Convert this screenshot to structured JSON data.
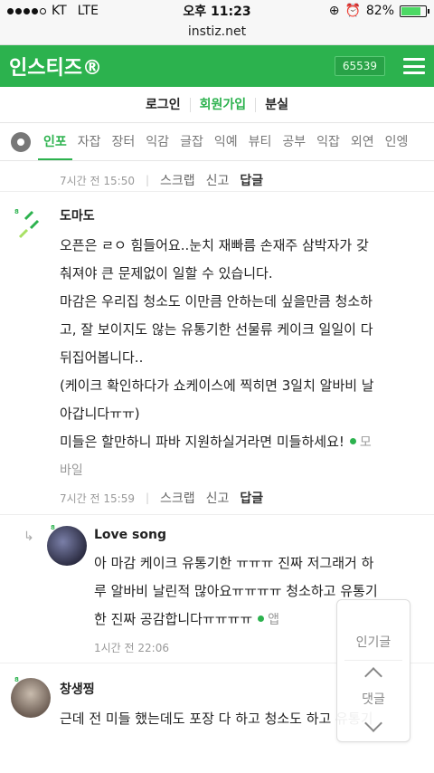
{
  "status": {
    "carrier": "KT",
    "network": "LTE",
    "time": "오후 11:23",
    "battery": "82%",
    "battery_level": 0.82
  },
  "url": "instiz.net",
  "brand": {
    "logo": "인스티즈®",
    "count": "65539"
  },
  "auth": {
    "login": "로그인",
    "signup": "회원가입",
    "lost": "분실"
  },
  "tabs": [
    "인포",
    "자잡",
    "장터",
    "익감",
    "글잡",
    "익예",
    "뷰티",
    "공부",
    "익잡",
    "외연",
    "인엥"
  ],
  "actions": {
    "scrap": "스크랩",
    "report": "신고",
    "reply": "답글"
  },
  "top_meta": {
    "time": "7시간 전 15:50"
  },
  "comments": [
    {
      "name": "도마도",
      "lines": [
        "오픈은 ㄹㅇ 힘들어요..눈치 재빠름 손재주 삼박자가 갖",
        "춰져야 큰 문제없이 일할 수 있습니다.",
        "마감은 우리집 청소도 이만큼 안하는데 싶을만큼 청소하",
        "고, 잘 보이지도 않는 유통기한 선물류 케이크 일일이 다",
        "뒤집어봅니다..",
        "(케이크 확인하다가 쇼케이스에 찍히면 3일치 알바비 날",
        "아갑니다ㅠㅠ)",
        "미들은 할만하니 파바 지원하실거라면 미들하세요!"
      ],
      "app_tag_1": "모",
      "app_tag_2": "바일",
      "time": "7시간 전 15:59"
    },
    {
      "name": "Love song",
      "lines": [
        "아 마감 케이크 유통기한 ㅠㅠㅠ 진짜 저그래거 하",
        "루 알바비 날린적 많아요ㅠㅠㅠㅠ 청소하고 유통기",
        "한 진짜 공감합니다ㅠㅠㅠㅠ"
      ],
      "app_tag": "앱",
      "time": "1시간 전 22:06"
    },
    {
      "name": "창생찡",
      "lines": [
        "근데 전 미들 했는데도 포장 다 하고 청소도 하고 유통기"
      ]
    }
  ],
  "float_panel": {
    "hot": "인기글",
    "comments": "댓글"
  },
  "colors": {
    "brand": "#2cb24e"
  }
}
